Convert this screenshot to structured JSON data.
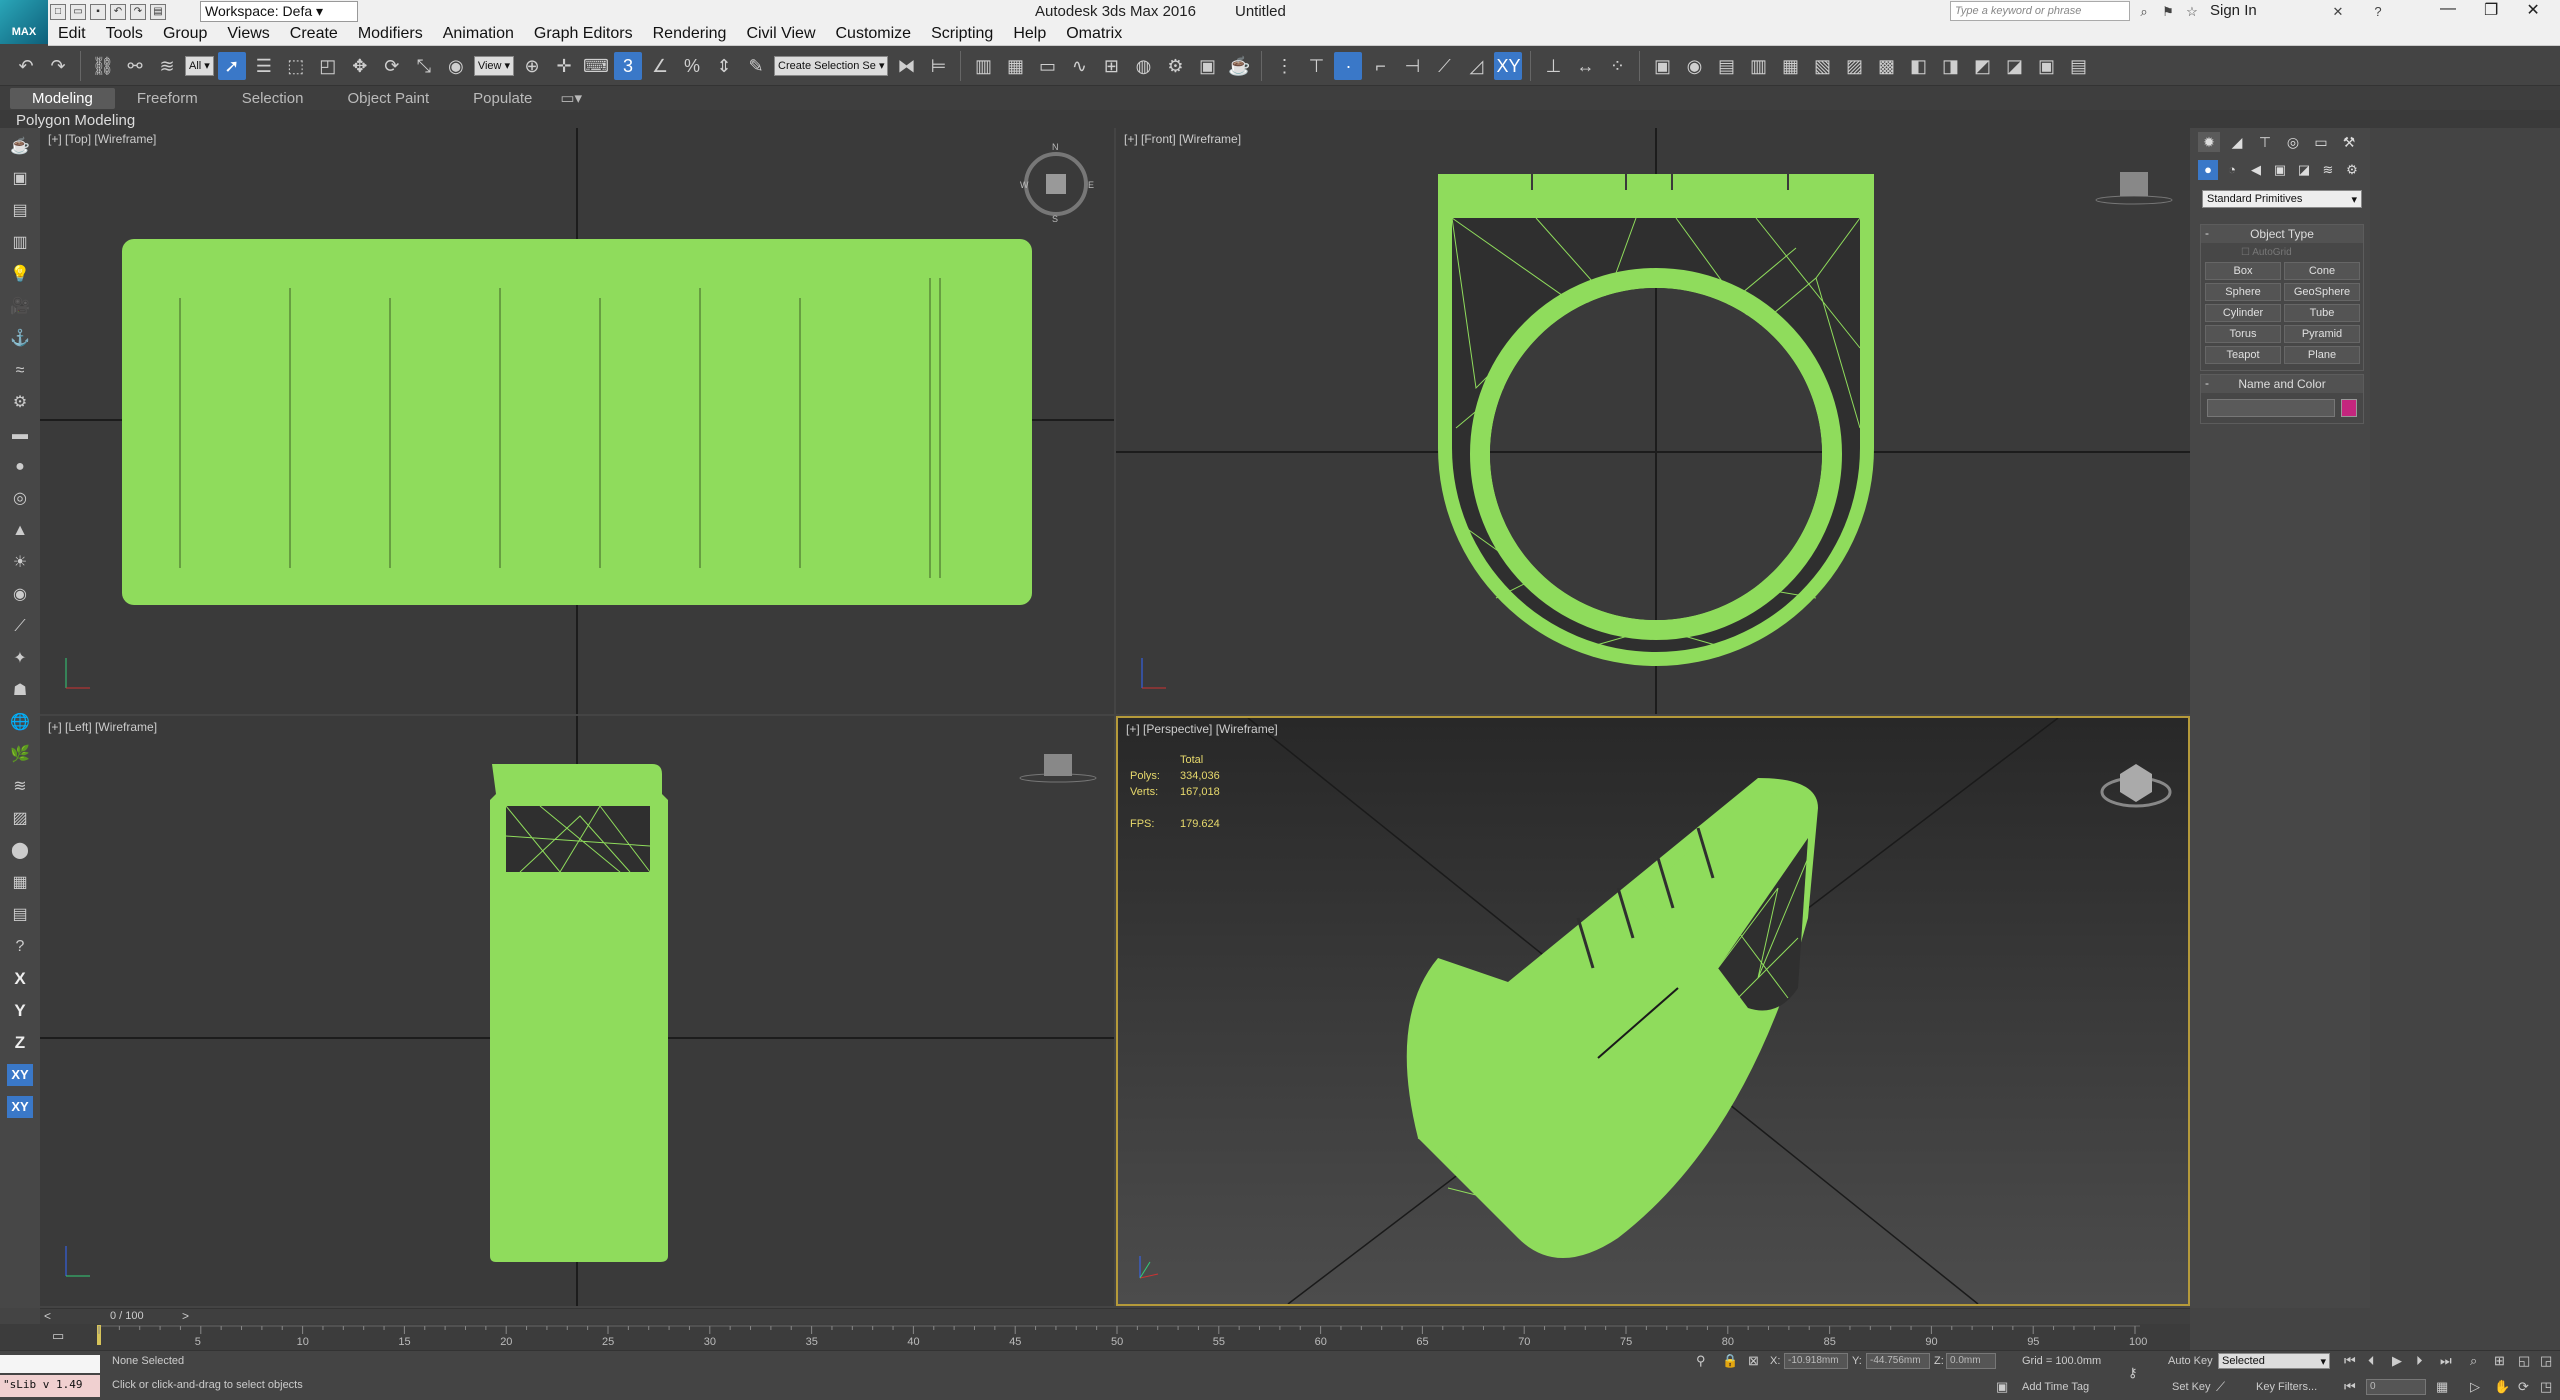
{
  "titlebar": {
    "app_title": "Autodesk 3ds Max 2016",
    "doc_title": "Untitled",
    "logo_text": "MAX",
    "workspace": "Workspace: Defa",
    "search_placeholder": "Type a keyword or phrase",
    "sign_in": "Sign In"
  },
  "menu": [
    "Edit",
    "Tools",
    "Group",
    "Views",
    "Create",
    "Modifiers",
    "Animation",
    "Graph Editors",
    "Rendering",
    "Civil View",
    "Customize",
    "Scripting",
    "Help",
    "Omatrix"
  ],
  "toolbar": {
    "filter_value": "All",
    "refcoord_value": "View",
    "selection_set_placeholder": "Create Selection Se"
  },
  "ribbon": {
    "tabs": [
      "Modeling",
      "Freeform",
      "Selection",
      "Object Paint",
      "Populate"
    ],
    "active_tab": "Modeling",
    "sub_label": "Polygon Modeling"
  },
  "leftbar": {
    "axis_labels": [
      "X",
      "Y",
      "Z",
      "XY",
      "XY"
    ]
  },
  "viewports": {
    "top": {
      "label": "[+] [Top] [Wireframe]"
    },
    "front": {
      "label": "[+] [Front] [Wireframe]"
    },
    "left": {
      "label": "[+] [Left] [Wireframe]"
    },
    "perspective": {
      "label": "[+] [Perspective] [Wireframe]",
      "stats_total": "Total",
      "polys_label": "Polys:",
      "polys_value": "334,036",
      "verts_label": "Verts:",
      "verts_value": "167,018",
      "fps_label": "FPS:",
      "fps_value": "179.624"
    },
    "wire_color": "#8fdc5c"
  },
  "command_panel": {
    "primitive_type": "Standard Primitives",
    "object_type_header": "Object Type",
    "autogrid": "AutoGrid",
    "buttons": [
      "Box",
      "Cone",
      "Sphere",
      "GeoSphere",
      "Cylinder",
      "Tube",
      "Torus",
      "Pyramid",
      "Teapot",
      "Plane"
    ],
    "name_color_header": "Name and Color",
    "object_color": "#c4267e"
  },
  "timeline": {
    "frame_counter": "0 / 100",
    "ticks": [
      "5",
      "10",
      "15",
      "20",
      "25",
      "30",
      "35",
      "40",
      "45",
      "50",
      "55",
      "60",
      "65",
      "70",
      "75",
      "80",
      "85",
      "90",
      "95",
      "100"
    ]
  },
  "status": {
    "maxscript": "\"sLib v 1.49",
    "selection": "None Selected",
    "prompt": "Click or click-and-drag to select objects",
    "x_label": "X:",
    "x_value": "-10.918mm",
    "y_label": "Y:",
    "y_value": "-44.756mm",
    "z_label": "Z:",
    "z_value": "0.0mm",
    "grid": "Grid = 100.0mm",
    "add_time_tag": "Add Time Tag",
    "auto_key": "Auto Key",
    "set_key": "Set Key",
    "key_mode": "Selected",
    "key_filters": "Key Filters...",
    "current_frame": "0"
  }
}
